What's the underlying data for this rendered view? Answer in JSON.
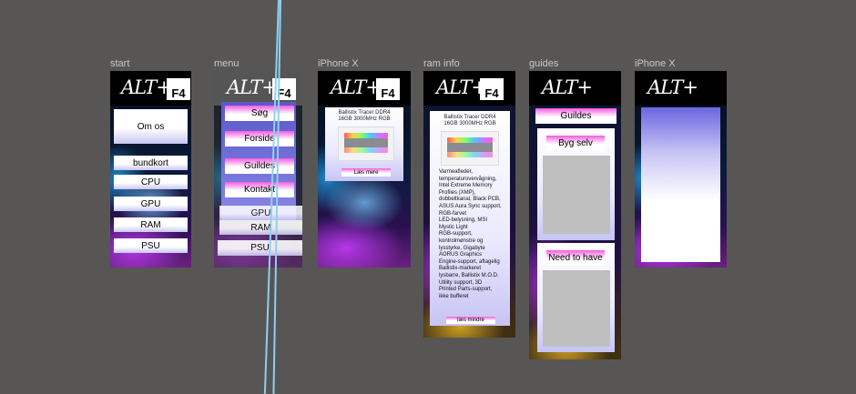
{
  "frames": {
    "start": {
      "label": "start",
      "logo_text": "ALT+",
      "logo_badge": "F4",
      "about_button": "Om os",
      "nav_items": [
        "bundkort",
        "CPU",
        "GPU",
        "RAM",
        "PSU"
      ]
    },
    "menu": {
      "label": "menu",
      "logo_text": "ALT+",
      "logo_badge": "F4",
      "menu_items": [
        "Søg",
        "Forside",
        "Guildes",
        "Kontakt"
      ],
      "behind_items": [
        "GPU",
        "RAM",
        "PSU"
      ]
    },
    "iphone1": {
      "label": "iPhone X",
      "logo_text": "ALT+",
      "logo_badge": "F4",
      "product_title": "Ballistix Tracer DDR4\n16GB 3000MHz RGB",
      "read_more": "Læs mere"
    },
    "raminfo": {
      "label": "ram info",
      "logo_text": "ALT+",
      "logo_badge": "F4",
      "product_title": "Ballistix Tracer DDR4\n16GB 3000MHz RGB",
      "description": "Varmeafleder,\ntemperaturovervågning,\nIntel Extreme Memory\nProfiles (XMP),\ndobbeltkanal, Black PCB,\nASUS Aura Sync support,\nRGB-farvet\nLED-belysning, MSI\nMystic Light\nRGB-support,\nkontrolmønstre og\nlysstyrke, Gigabyte\nAORUS Graphics\nEngine-support, aftagelig\nBallistix-markeret\nlysbarre, Ballistix M.O.D.\nUtility support, 3D\nPrinted Parts-support,\nikke bufferet",
      "read_less": "læs mindre"
    },
    "guides": {
      "label": "guides",
      "logo_text": "ALT+",
      "title": "Guildes",
      "build_yourself": "Byg selv",
      "need_to_have": "Need to have"
    },
    "iphone2": {
      "label": "iPhone X",
      "logo_text": "ALT+"
    }
  },
  "colors": {
    "canvas": "#575654",
    "accent_pink": "#f45ae0",
    "pill_lavender": "#c9c6f2",
    "connector_line": "#8fd0f2"
  }
}
